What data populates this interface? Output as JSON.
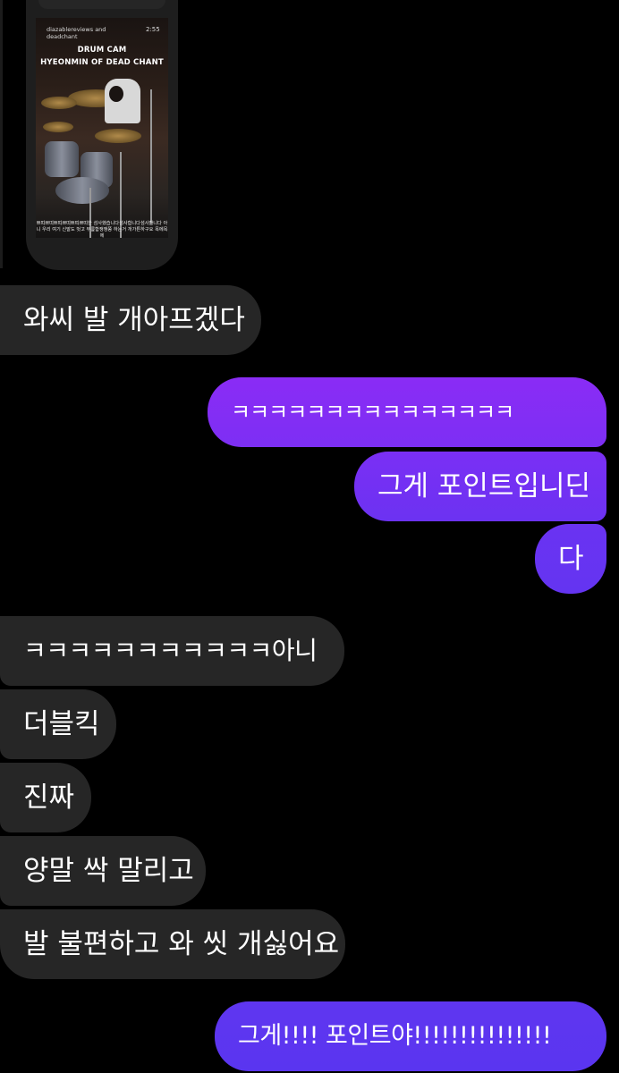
{
  "shared_reel": {
    "author": "diazablereviews and deadchant",
    "duration": "2:55",
    "title_line1": "DRUM CAM",
    "title_line2": "HYEONMIN OF DEAD CHANT",
    "caption": "쁘띠쁘띠쁘띠쁘띠쁘띠쁘띠한 섬사했습니다섬사합니다섬사합니다 아니 우리 여기 신발도 벗고 무릎합쟁쟁쭝 하는거 개가튼하구요 목에목에"
  },
  "messages": [
    {
      "side": "received",
      "text": "와씨 발 개아프겠다"
    },
    {
      "side": "sent",
      "text": "ㅋㅋㅋㅋㅋㅋㅋㅋㅋㅋㅋㅋㅋㅋㅋ"
    },
    {
      "side": "sent",
      "text": "그게 포인트입니딘"
    },
    {
      "side": "sent",
      "text": "다"
    },
    {
      "side": "received",
      "text": "ㅋㅋㅋㅋㅋㅋㅋㅋㅋㅋㅋ아니"
    },
    {
      "side": "received",
      "text": "더블킥"
    },
    {
      "side": "received",
      "text": "진짜"
    },
    {
      "side": "received",
      "text": "양말 싹 말리고"
    },
    {
      "side": "received",
      "text": "발 불편하고 와 씻 개싫어요"
    },
    {
      "side": "sent",
      "text": "그게!!!! 포인트야!!!!!!!!!!!!!!!"
    }
  ],
  "colors": {
    "background": "#000000",
    "received_bubble": "#262626",
    "sent_gradient_top": "#8a2cf5",
    "sent_gradient_bottom": "#5a35f0"
  }
}
